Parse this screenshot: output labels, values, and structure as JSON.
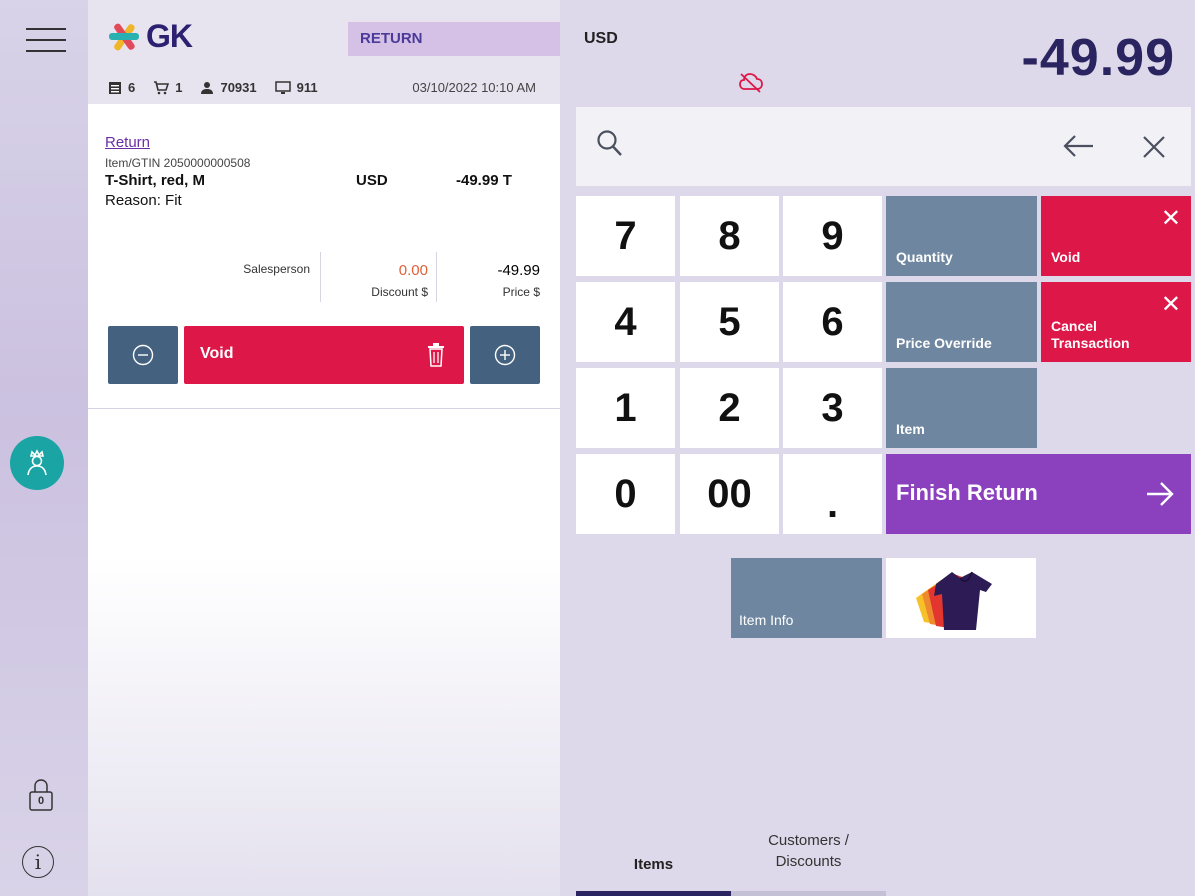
{
  "sidebar": {
    "menu_icon": "hamburger-menu-icon",
    "avatar_icon": "cashier-avatar-icon",
    "lock_icon": "drawer-lock-icon",
    "lock_badge": "0",
    "info_icon": "info-icon",
    "info_glyph": "i"
  },
  "header": {
    "logo_text": "GK",
    "mode": "RETURN",
    "status": {
      "receipts": "6",
      "cart_items": "1",
      "user_id": "70931",
      "terminal": "911",
      "datetime": "03/10/2022 10:10 AM"
    }
  },
  "line_item": {
    "type": "Return",
    "gtin": "Item/GTIN 2050000000508",
    "description": "T-Shirt, red, M",
    "currency": "USD",
    "amount": "-49.99 T",
    "reason": "Reason: Fit",
    "fields": [
      {
        "label": "Salesperson",
        "value": ""
      },
      {
        "label": "Discount $",
        "value": "0.00"
      },
      {
        "label": "Price $",
        "value": "-49.99"
      }
    ],
    "void_label": "Void"
  },
  "totals": {
    "currency": "USD",
    "total": "-49.99",
    "cloud_status_icon": "cloud-offline-icon"
  },
  "keypad": {
    "keys": [
      "7",
      "8",
      "9",
      "4",
      "5",
      "6",
      "1",
      "2",
      "3",
      "0",
      "00",
      "."
    ],
    "functions": {
      "quantity": "Quantity",
      "void": "Void",
      "price_override": "Price Override",
      "cancel_line1": "Cancel",
      "cancel_line2": "Transaction",
      "item": "Item",
      "finish": "Finish Return",
      "item_info": "Item Info"
    }
  },
  "tabs": [
    {
      "label": "Items",
      "active": true
    },
    {
      "label_line1": "Customers /",
      "label_line2": "Discounts",
      "active": false
    }
  ],
  "colors": {
    "brand_navy": "#2a2560",
    "void_red": "#dd1748",
    "finish_purple": "#8b40bd",
    "function_gray": "#6f86a0",
    "line_button_blue": "#44627f",
    "avatar_teal": "#1aa4a4",
    "discount_orange": "#e0603a"
  }
}
